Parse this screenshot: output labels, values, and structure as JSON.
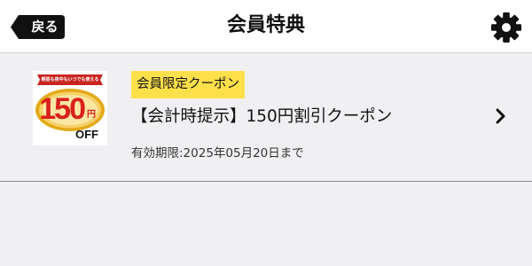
{
  "header": {
    "back_label": "戻る",
    "title": "会員特典",
    "settings_icon": "gear-icon"
  },
  "coupons": [
    {
      "badge": "会員限定クーポン",
      "title": "【会計時提示】150円割引クーポン",
      "expiry": "有効期限:2025年05月20日まで",
      "thumbnail": {
        "tag": "朝昼も夜中もいつでも使える",
        "amount": "150",
        "currency": "円",
        "off": "OFF"
      },
      "chevron_icon": "chevron-right-icon"
    }
  ],
  "colors": {
    "header_bg": "#ffffff",
    "page_bg": "#f0f0f3",
    "back_button_bg": "#111111",
    "badge_bg": "#ffe04a",
    "amount_red": "#d9201d",
    "gold": "#e3a917"
  }
}
